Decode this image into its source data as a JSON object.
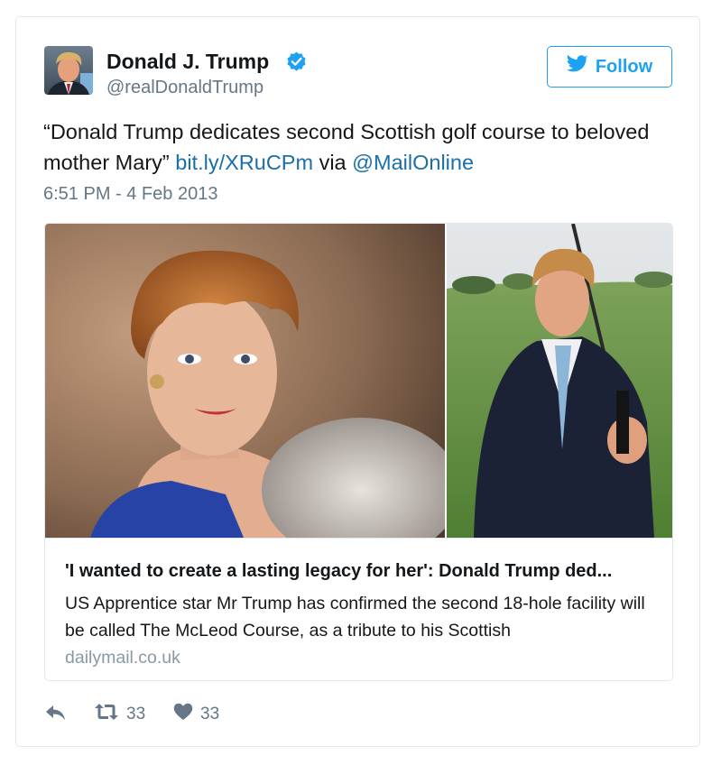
{
  "tweet": {
    "author": {
      "name": "Donald J. Trump",
      "handle": "@realDonaldTrump",
      "verified": true
    },
    "follow_label": "Follow",
    "text_prefix": "“Donald Trump dedicates second Scottish golf course to beloved mother Mary” ",
    "link_text": "bit.ly/XRuCPm",
    "text_middle": " via ",
    "mention_text": "@MailOnline",
    "timestamp": "6:51 PM - 4 Feb 2013",
    "card": {
      "title": "'I wanted to create a lasting legacy for her': Donald Trump ded...",
      "description": "US Apprentice star Mr Trump has confirmed the second 18-hole facility will be called The McLeod Course, as a tribute to his Scottish",
      "domain": "dailymail.co.uk"
    },
    "actions": {
      "reply_icon": "reply-icon",
      "retweet_icon": "retweet-icon",
      "retweet_count": "33",
      "like_icon": "heart-icon",
      "like_count": "33"
    },
    "colors": {
      "accent": "#1da1f2",
      "link": "#1b6fa8",
      "secondary_text": "#657786",
      "border": "#e1e8ed"
    }
  }
}
